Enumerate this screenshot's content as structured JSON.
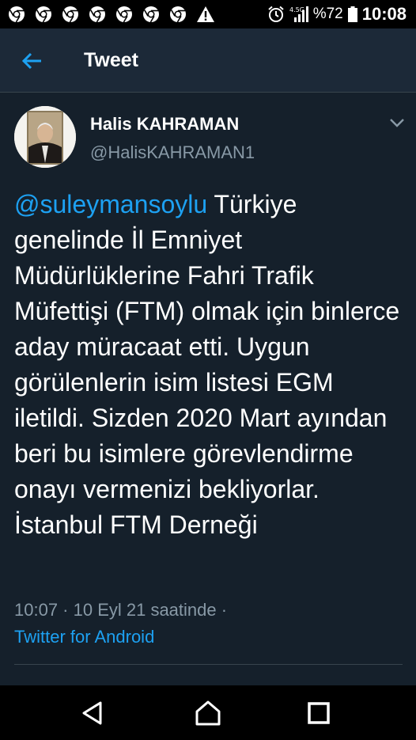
{
  "status_bar": {
    "notification_icons": [
      "chrome-icon",
      "chrome-icon",
      "chrome-icon",
      "chrome-icon",
      "chrome-icon",
      "chrome-icon",
      "chrome-icon",
      "warning-icon"
    ],
    "network_label": "4.5G",
    "battery_percent": "%72",
    "time": "10:08"
  },
  "header": {
    "title": "Tweet",
    "back_icon": "arrow-left-icon"
  },
  "tweet": {
    "author_name": "Halis KAHRAMAN",
    "author_handle": "@HalisKAHRAMAN1",
    "mention": "@suleymansoylu",
    "body": " Türkiye genelinde İl Emniyet Müdürlüklerine Fahri Trafik Müfettişi (FTM) olmak için binlerce aday müracaat etti. Uygun görülenlerin isim listesi EGM iletildi. Sizden 2020 Mart ayından beri bu isimlere görevlendirme onayı vermenizi bekliyorlar. İstanbul FTM Derneği",
    "timestamp": "10:07 · 10 Eyl 21 saatinde ·",
    "source": "Twitter for Android"
  },
  "colors": {
    "background": "#15202b",
    "header_bg": "#1c2938",
    "link": "#1da1f2",
    "secondary_text": "#8899a6",
    "divider": "#38444d"
  },
  "nav_bar": {
    "icons": [
      "back-triangle-icon",
      "home-icon",
      "recents-square-icon"
    ]
  }
}
